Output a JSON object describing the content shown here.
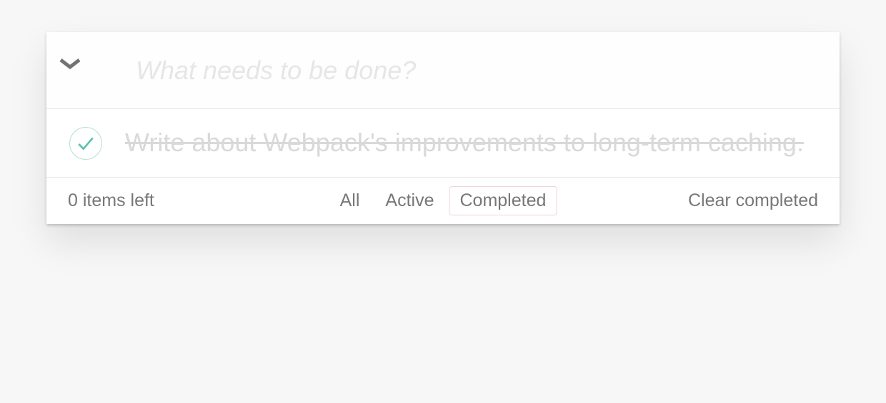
{
  "input": {
    "placeholder": "What needs to be done?",
    "value": ""
  },
  "todos": [
    {
      "text": "Write about Webpack's improvements to long-term caching.",
      "completed": true
    }
  ],
  "footer": {
    "count_text": "0 items left",
    "filters": {
      "all": "All",
      "active": "Active",
      "completed": "Completed"
    },
    "active_filter": "completed",
    "clear_label": "Clear completed"
  },
  "colors": {
    "check": "#5dc2af",
    "placeholder": "#e6e6e6",
    "completed_text": "#d9d9d9"
  }
}
